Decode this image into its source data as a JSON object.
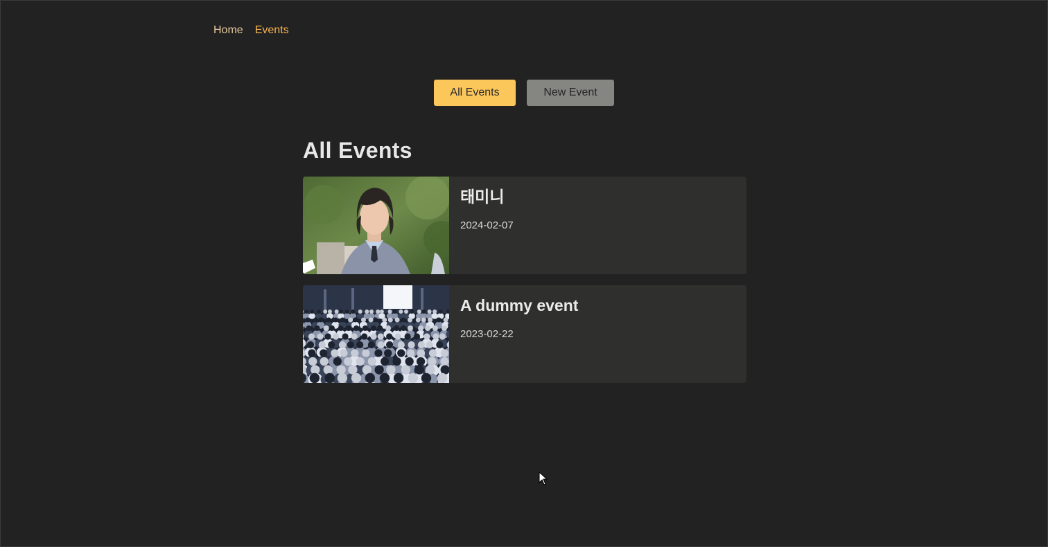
{
  "nav": {
    "home_label": "Home",
    "events_label": "Events"
  },
  "actions": {
    "all_events_label": "All Events",
    "new_event_label": "New Event"
  },
  "page_title": "All Events",
  "events": [
    {
      "title": "태미니",
      "date": "2024-02-07",
      "image": "portrait-photo"
    },
    {
      "title": "A dummy event",
      "date": "2023-02-22",
      "image": "crowd-photo"
    }
  ],
  "colors": {
    "background": "#222222",
    "accent": "#fcc75a",
    "active_nav": "#f5b452",
    "card": "#2f2f2d",
    "secondary_button": "#858582"
  }
}
